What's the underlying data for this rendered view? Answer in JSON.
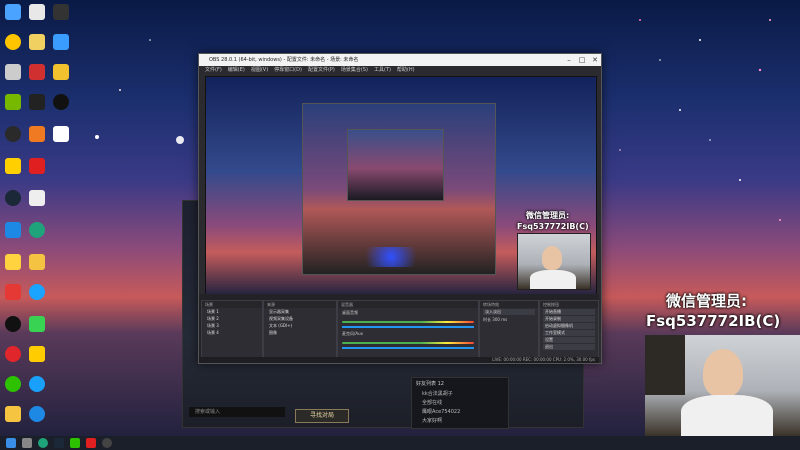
{
  "window": {
    "title": "OBS 28.0.1 (64-bit, windows) - 配置文件: 未命名 - 场景: 未命名",
    "menu": [
      "文件(F)",
      "编辑(E)",
      "视图(V)",
      "停靠窗口(D)",
      "配置文件(P)",
      "场景集合(S)",
      "工具(T)",
      "帮助(H)"
    ]
  },
  "docks": {
    "scenes_title": "场景",
    "sources_title": "来源",
    "mixer_title": "混音器",
    "transitions_title": "转场特效",
    "controls_title": "控制按钮",
    "scenes": [
      "场景 1",
      "场景 2",
      "场景 3",
      "场景 4"
    ],
    "sources": [
      "显示器采集",
      "视频采集设备",
      "文本 (GDI+)",
      "图像"
    ],
    "mixer_channels": [
      "桌面音频",
      "麦克风/Aux"
    ],
    "transition_value": "淡入淡出",
    "duration_label": "时长",
    "duration_value": "300 ms",
    "controls": [
      "开始直播",
      "开始录制",
      "启动虚拟摄像机",
      "工作室模式",
      "设置",
      "退出"
    ]
  },
  "status_bar": {
    "live": "LIVE: 00:00:00",
    "rec": "REC: 00:00:00",
    "cpu": "CPU: 2.0%, 30.00 fps"
  },
  "overlay": {
    "line1": "微信管理员:",
    "line2": "Fsq537772IB(C)"
  },
  "game_panel": {
    "search_placeholder": "搜索或输入",
    "button": "寻找对局",
    "list_title": "好友列表",
    "list_count": "12",
    "items": [
      "kk合法黑胡子",
      "全部在线",
      "鹰眼Ace754022",
      "大家好啊"
    ]
  },
  "taskbar": {
    "start_icon": "windows-icon"
  },
  "colors": {
    "accent_red": "#c75a5a",
    "obs_bg": "#2b2b2f"
  }
}
